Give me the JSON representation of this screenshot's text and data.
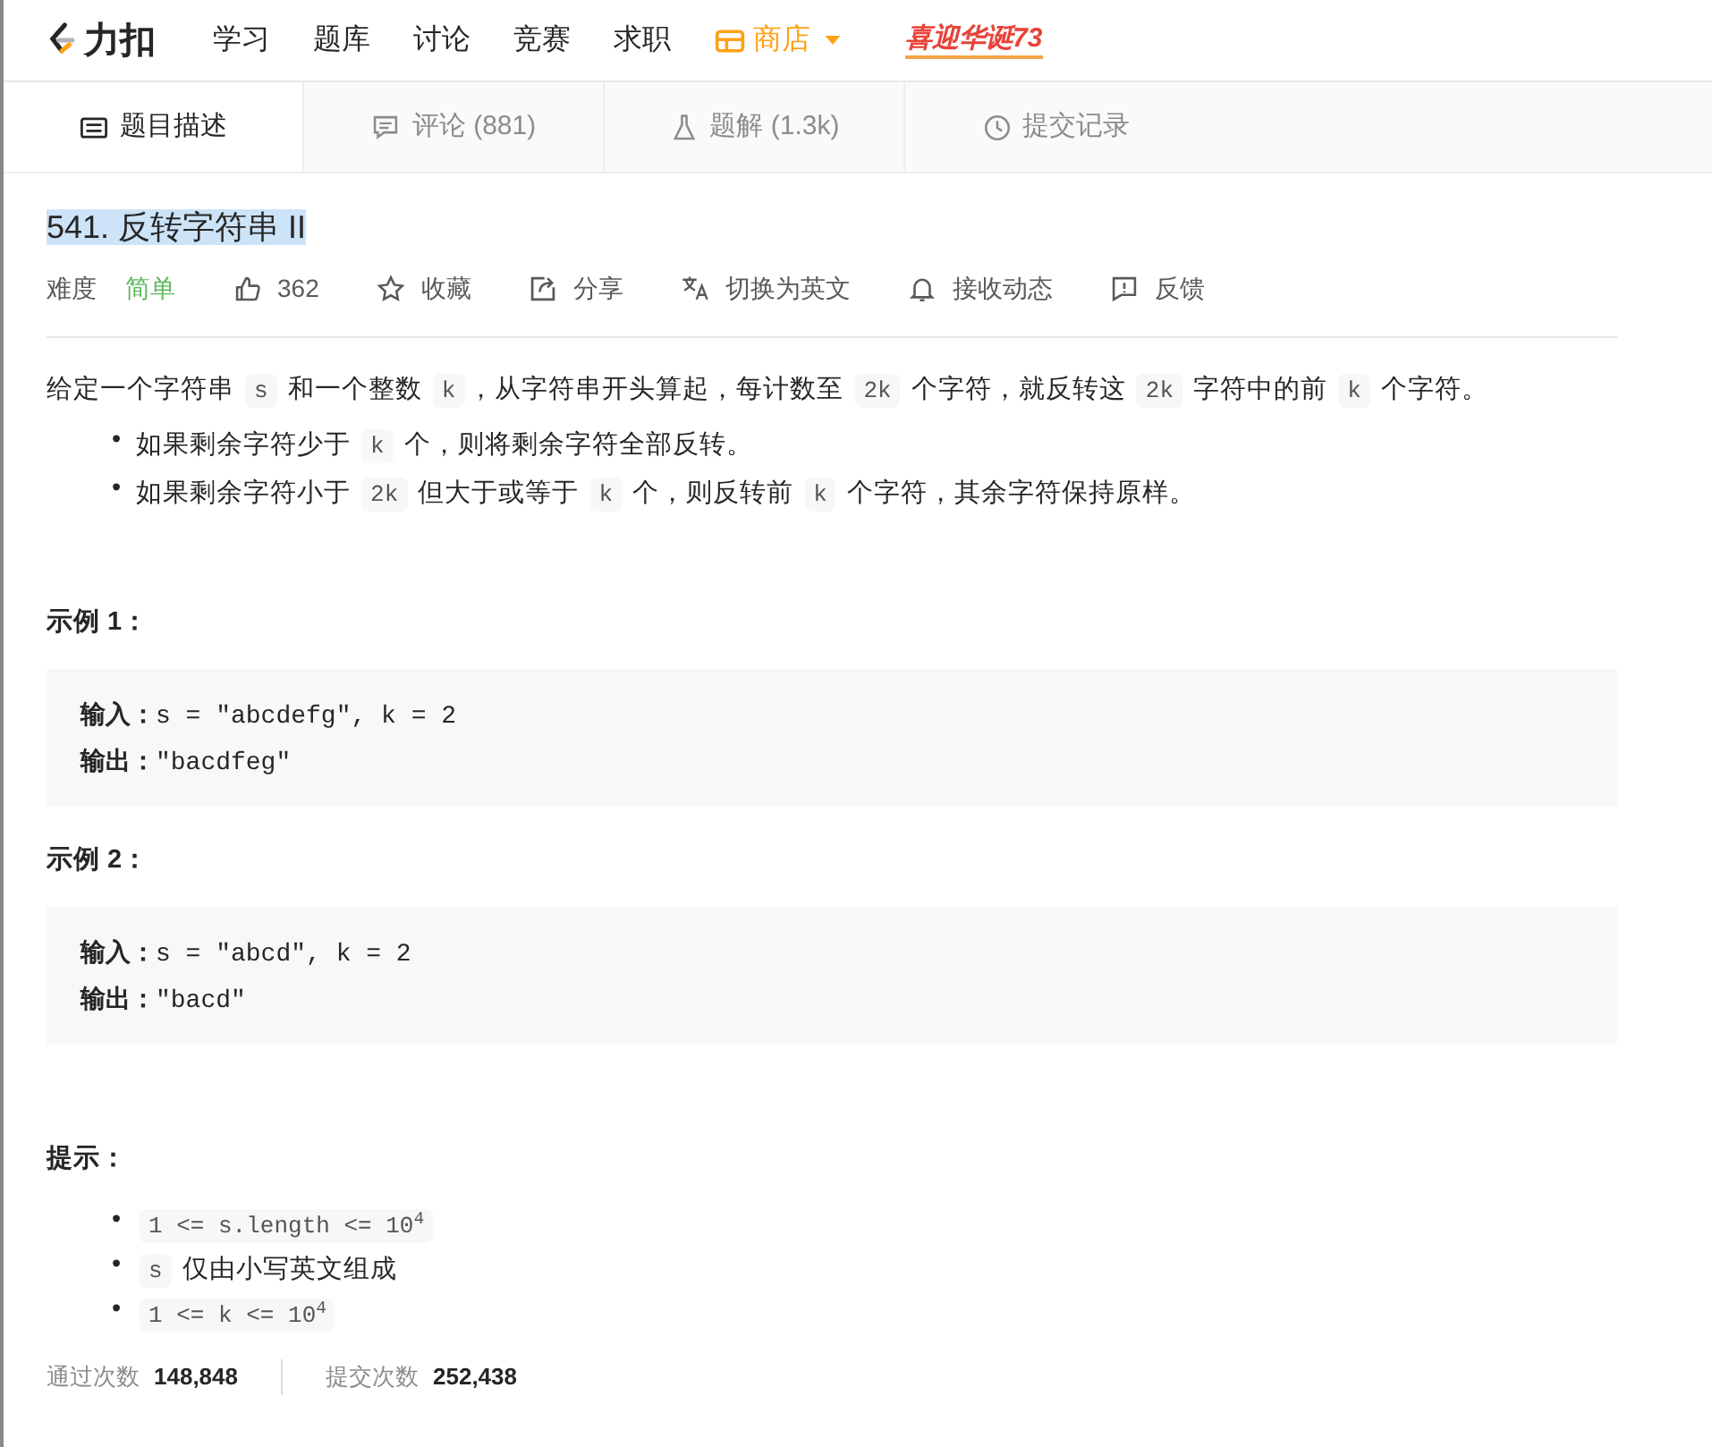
{
  "nav": {
    "logo": "力扣",
    "items": [
      {
        "label": "学习",
        "kind": "link"
      },
      {
        "label": "题库",
        "kind": "link"
      },
      {
        "label": "讨论",
        "kind": "link"
      },
      {
        "label": "竞赛",
        "kind": "link"
      },
      {
        "label": "求职",
        "kind": "link"
      },
      {
        "label": "商店",
        "kind": "store"
      }
    ],
    "banner": "喜迎华诞73"
  },
  "tabs": [
    {
      "label": "题目描述",
      "kind": "description",
      "selected": true
    },
    {
      "label": "评论 (881)",
      "kind": "comment",
      "selected": false
    },
    {
      "label": "题解 (1.3k)",
      "kind": "flask",
      "selected": false
    },
    {
      "label": "提交记录",
      "kind": "clock",
      "selected": false
    }
  ],
  "title": "541. 反转字符串 II",
  "meta": {
    "difficulty_label": "难度",
    "difficulty": "简单",
    "actions": [
      {
        "label": "362",
        "kind": "thumb"
      },
      {
        "label": "收藏",
        "kind": "star"
      },
      {
        "label": "分享",
        "kind": "share"
      },
      {
        "label": "切换为英文",
        "kind": "translate"
      },
      {
        "label": "接收动态",
        "kind": "bell"
      },
      {
        "label": "反馈",
        "kind": "feedback"
      }
    ]
  },
  "description": [
    {
      "kind": "text",
      "text": "给定一个字符串 "
    },
    {
      "kind": "code",
      "text": "s"
    },
    {
      "kind": "text",
      "text": " 和一个整数 "
    },
    {
      "kind": "code",
      "text": "k"
    },
    {
      "kind": "text",
      "text": "，从字符串开头算起，每计数至 "
    },
    {
      "kind": "code",
      "text": "2k"
    },
    {
      "kind": "text",
      "text": " 个字符，就反转这 "
    },
    {
      "kind": "code",
      "text": "2k"
    },
    {
      "kind": "text",
      "text": " 字符中的前 "
    },
    {
      "kind": "code",
      "text": "k"
    },
    {
      "kind": "text",
      "text": " 个字符。"
    }
  ],
  "rules": [
    {
      "bullet": "•",
      "segments": [
        {
          "kind": "text",
          "text": "如果剩余字符少于 "
        },
        {
          "kind": "code",
          "text": "k"
        },
        {
          "kind": "text",
          "text": " 个，则将剩余字符全部反转。"
        }
      ]
    },
    {
      "bullet": "•",
      "segments": [
        {
          "kind": "text",
          "text": "如果剩余字符小于 "
        },
        {
          "kind": "code",
          "text": "2k"
        },
        {
          "kind": "text",
          "text": " 但大于或等于 "
        },
        {
          "kind": "code",
          "text": "k"
        },
        {
          "kind": "text",
          "text": " 个，则反转前 "
        },
        {
          "kind": "code",
          "text": "k"
        },
        {
          "kind": "text",
          "text": " 个字符，其余字符保持原样。"
        }
      ]
    }
  ],
  "examples": [
    {
      "heading": "示例 1：",
      "input_label": "输入：",
      "input": "s = \"abcdefg\", k = 2",
      "output_label": "输出：",
      "output": "\"bacdfeg\""
    },
    {
      "heading": "示例 2：",
      "input_label": "输入：",
      "input": "s = \"abcd\", k = 2",
      "output_label": "输出：",
      "output": "\"bacd\""
    }
  ],
  "hints": {
    "heading": "提示：",
    "items": [
      {
        "bullet": "•",
        "segments": [
          {
            "kind": "code",
            "text": "1 <= s.length <= 10$^{4}$"
          }
        ]
      },
      {
        "bullet": "•",
        "segments": [
          {
            "kind": "code",
            "text": "s"
          },
          {
            "kind": "text",
            "text": " 仅由小写英文组成"
          }
        ]
      },
      {
        "bullet": "•",
        "segments": [
          {
            "kind": "code",
            "text": "1 <= k <= 10$^{4}$"
          }
        ]
      }
    ]
  },
  "stats": [
    {
      "label": "通过次数",
      "value": "148,848"
    },
    {
      "label": "提交次数",
      "value": "252,438"
    }
  ]
}
